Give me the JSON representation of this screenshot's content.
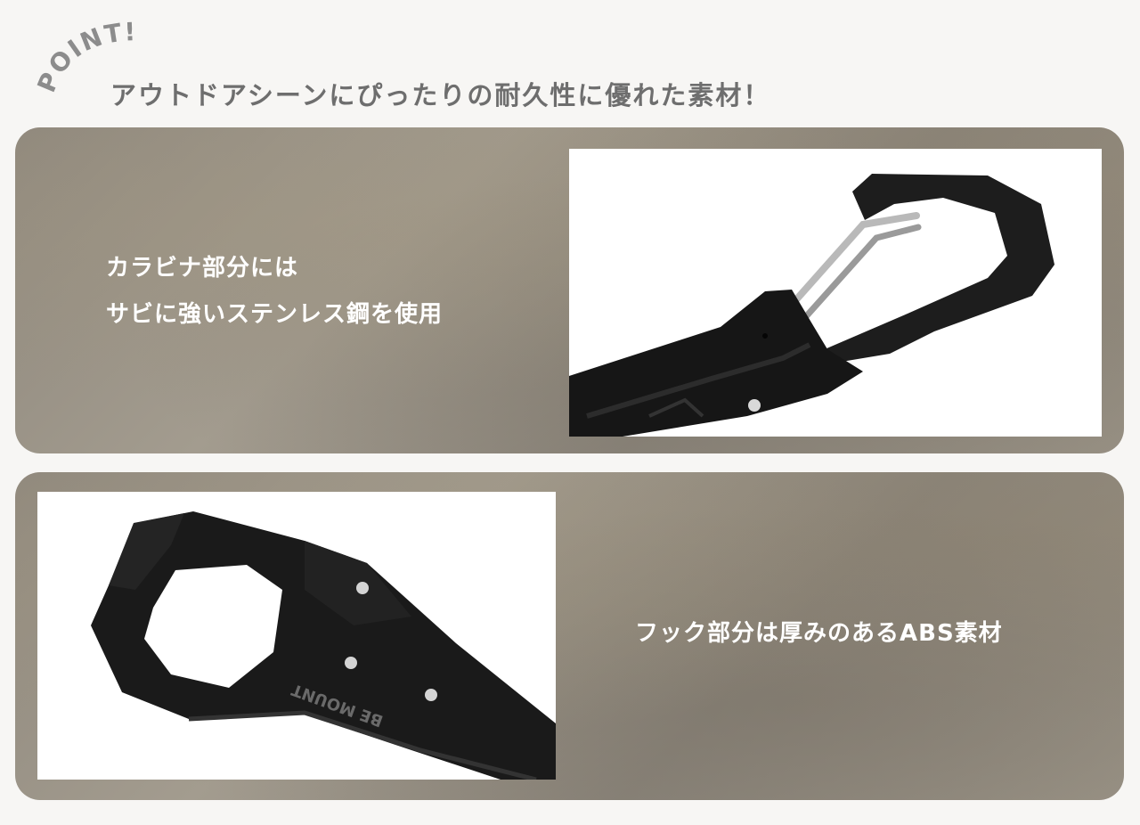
{
  "badge": {
    "text": "POINT!"
  },
  "heading": {
    "text": "アウトドアシーンにぴったりの耐久性に優れた素材！"
  },
  "panels": [
    {
      "lines": [
        "カラビナ部分には",
        "サビに強いステンレス鋼を使用"
      ]
    },
    {
      "lines": [
        "フック部分は厚みのあるABS素材"
      ]
    }
  ],
  "product_engraving": "BE MOUNT",
  "colors": {
    "panel_stone": "#958e82",
    "heading": "#6e6e6e",
    "caption": "#ffffff",
    "product": "#1b1b1b"
  }
}
